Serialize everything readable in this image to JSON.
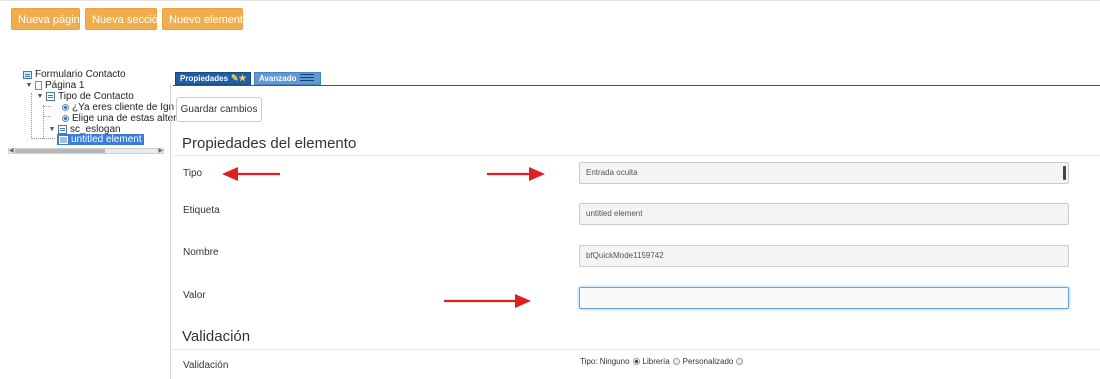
{
  "toolbar": {
    "new_page": "Nueva página",
    "new_section": "Nueva sección",
    "new_element": "Nuevo elemento",
    "accent": "#f0ad4e"
  },
  "tree": {
    "root": "Formulario Contacto",
    "page": "Página 1",
    "section": "Tipo de Contacto",
    "opt1": "¿Ya eres cliente de Ign",
    "opt2": "Elige una de estas alter",
    "slogan": "sc_eslogan",
    "selected": "untitled element"
  },
  "tabs": {
    "properties": "Propiedades",
    "advanced": "Avanzado"
  },
  "actions": {
    "save": "Guardar cambios"
  },
  "section_props": "Propiedades del elemento",
  "fields": {
    "tipo": {
      "label": "Tipo",
      "value": "Entrada oculta"
    },
    "etiqueta": {
      "label": "Etiqueta",
      "value": "untitled element"
    },
    "nombre": {
      "label": "Nombre",
      "value": "bfQuickMode1159742"
    },
    "valor": {
      "label": "Valor",
      "value": ""
    }
  },
  "section_validation": "Validación",
  "validation": {
    "label": "Validación",
    "prefix": "Tipo: Ninguno",
    "opt_library": "Librería",
    "opt_custom": "Personalizado",
    "selected": "Ninguno"
  },
  "annotation_color": "#e02020"
}
